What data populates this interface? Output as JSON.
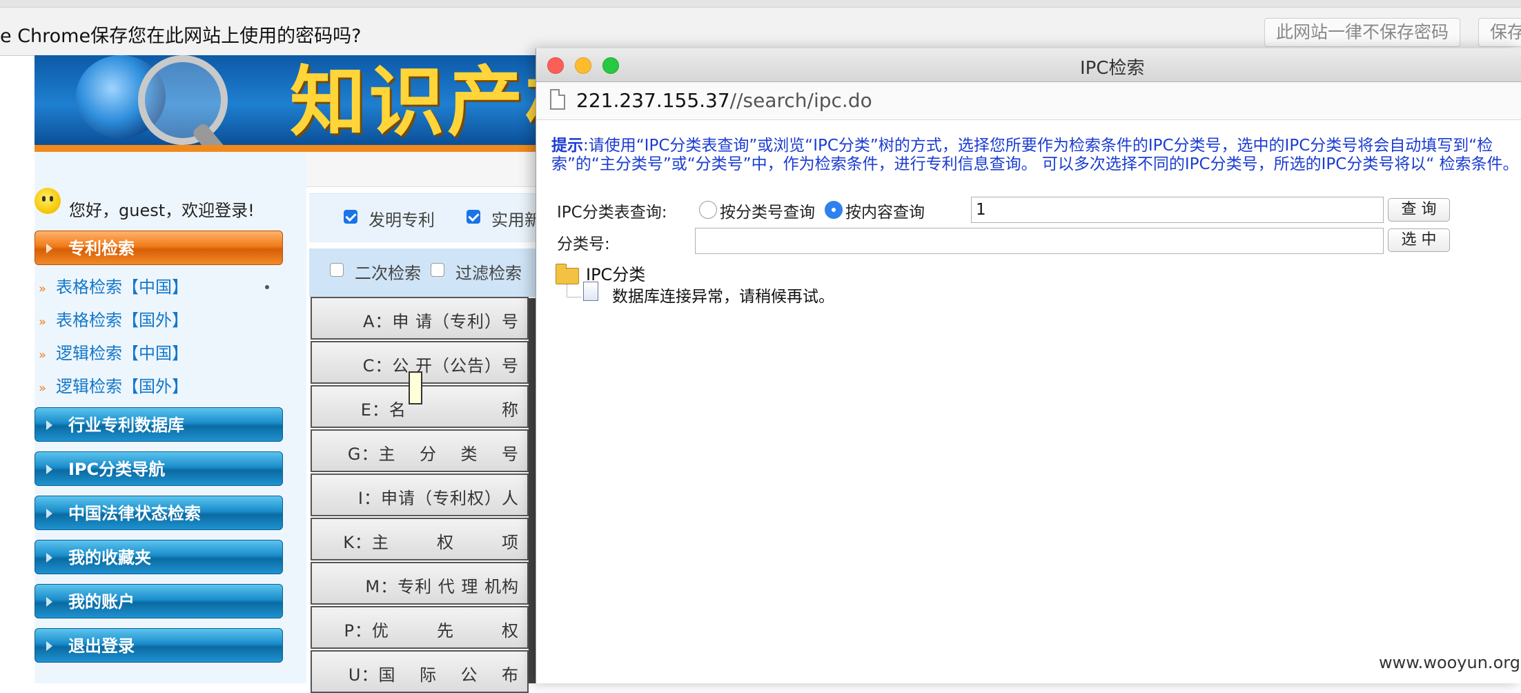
{
  "password_bar": {
    "prompt": "e Chrome保存您在此网站上使用的密码吗?",
    "never_button": "此网站一律不保存密码",
    "save_button": "保存"
  },
  "background_page": {
    "banner_title": "知识产权",
    "greeting": "您好，guest，欢迎登录!",
    "nav": {
      "patent_search": "专利检索",
      "sub_items": [
        "表格检索【中国】",
        "表格检索【国外】",
        "逻辑检索【中国】",
        "逻辑检索【国外】"
      ],
      "industry_db": "行业专利数据库",
      "ipc_nav": "IPC分类导航",
      "legal_status": "中国法律状态检索",
      "favorites": "我的收藏夹",
      "account": "我的账户",
      "logout": "退出登录"
    },
    "options": {
      "invention": "发明专利",
      "utility": "实用新",
      "secondary_search": "二次检索",
      "filter_search": "过滤检索"
    },
    "fields": [
      "A：申 请（专利）号",
      "C：公 开（公告）号",
      "E：名                称",
      "G：主    分    类    号",
      "I：申请（专利权）人",
      "K：主        权        项",
      "M：专利 代 理 机构",
      "P：优        先        权",
      "U：国    际    公    布"
    ]
  },
  "popup": {
    "window_title": "IPC检索",
    "url_host": "221.237.155.37",
    "url_path": "//search/ipc.do",
    "hint_label": "提示",
    "hint_text": ":请使用“IPC分类表查询”或浏览“IPC分类”树的方式，选择您所要作为检索条件的IPC分类号，选中的IPC分类号将会自动填写到“检索”的“主分类号”或“分类号”中，作为检索条件，进行专利信息查询。 可以多次选择不同的IPC分类号，所选的IPC分类号将以“ 检索条件。",
    "query_label": "IPC分类表查询:",
    "radio_by_code": "按分类号查询",
    "radio_by_content": "按内容查询",
    "query_value": "1",
    "query_button": "查 询",
    "class_label": "分类号:",
    "class_value": "",
    "select_button": "选 中",
    "tree_root": "IPC分类",
    "tree_message": "数据库连接异常，请稍候再试。"
  },
  "watermark": "www.wooyun.org"
}
